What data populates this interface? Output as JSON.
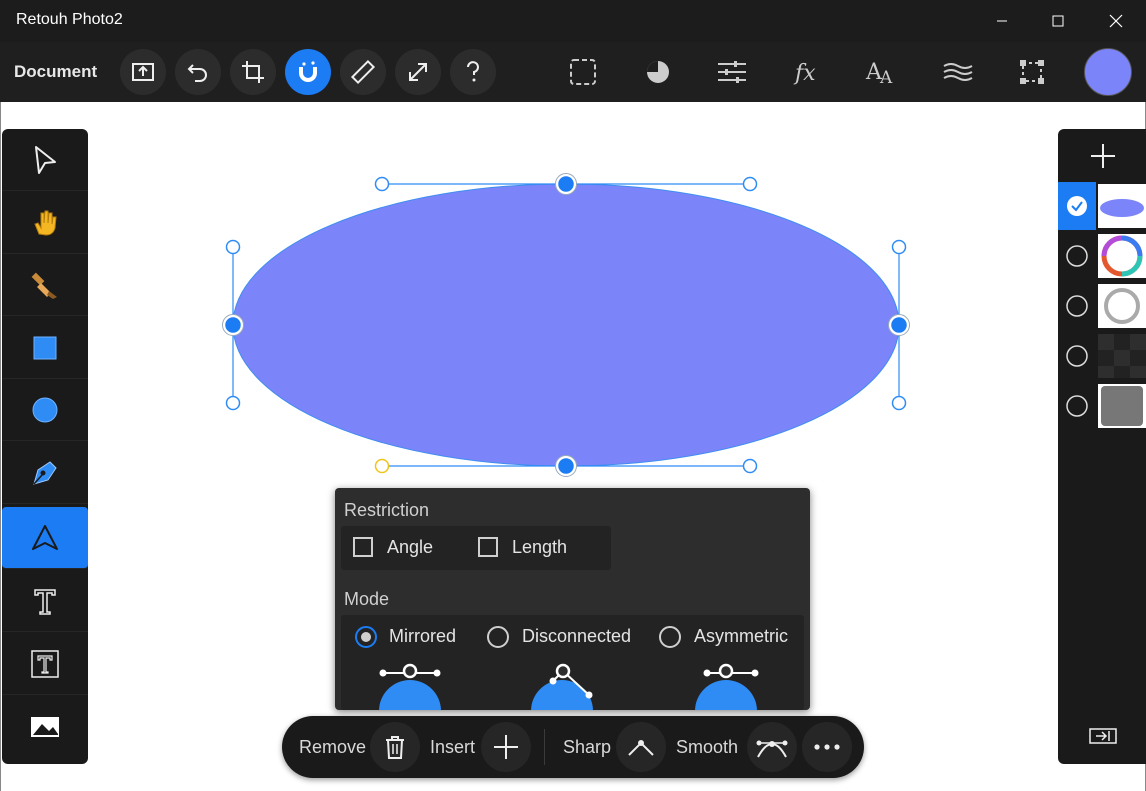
{
  "app": {
    "title": "Retouh Photo2"
  },
  "toolbar": {
    "document_label": "Document",
    "left_tools": [
      "export-icon",
      "undo-icon",
      "crop-icon",
      "snap-magnet-icon",
      "ruler-icon",
      "fullscreen-icon",
      "help-icon"
    ],
    "right_tools": [
      "selection-icon",
      "adjust-icon",
      "sliders-icon",
      "fx-icon",
      "text-style-icon",
      "effects-icon",
      "transform-icon"
    ],
    "active_tool": "snap-magnet-icon",
    "color": "#7b84f8"
  },
  "left_toolbar": {
    "tools": [
      "cursor-icon",
      "hand-icon",
      "brush-icon",
      "rectangle-icon",
      "ellipse-icon",
      "pen-icon",
      "node-icon",
      "text-icon",
      "text-frame-icon",
      "image-icon"
    ],
    "active": "node-icon"
  },
  "layers": {
    "add_icon": "plus-icon",
    "items": [
      {
        "name": "ellipse",
        "selected": true
      },
      {
        "name": "color ring",
        "selected": false
      },
      {
        "name": "gray ring",
        "selected": false
      },
      {
        "name": "dark pattern",
        "selected": false
      },
      {
        "name": "gray square",
        "selected": false
      }
    ],
    "footer_icon": "collapse-panel-icon"
  },
  "popup": {
    "restriction_label": "Restriction",
    "angle_label": "Angle",
    "length_label": "Length",
    "mode_label": "Mode",
    "modes": [
      {
        "label": "Mirrored",
        "checked": true
      },
      {
        "label": "Disconnected",
        "checked": false
      },
      {
        "label": "Asymmetric",
        "checked": false
      }
    ]
  },
  "bottom_bar": {
    "remove_label": "Remove",
    "insert_label": "Insert",
    "sharp_label": "Sharp",
    "smooth_label": "Smooth"
  },
  "colors": {
    "accent": "#1c7cf4",
    "shape_fill": "#7b84f8"
  }
}
